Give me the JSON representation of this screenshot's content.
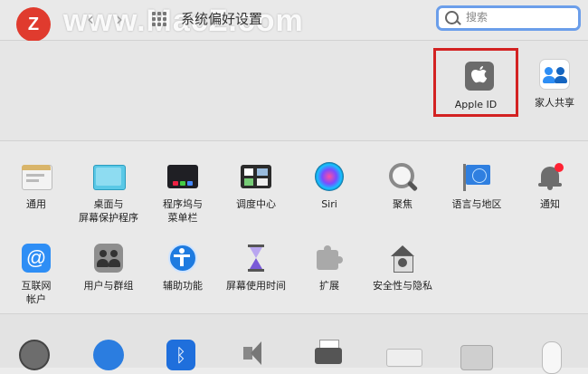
{
  "window": {
    "title": "系统偏好设置"
  },
  "watermark": {
    "text": "www.MacZ.com",
    "logo_letter": "Z"
  },
  "nav": {
    "back": "‹",
    "forward": "›"
  },
  "search": {
    "placeholder": "搜索"
  },
  "account": {
    "apple_id": {
      "label": "Apple ID",
      "icon": "apple-logo-icon"
    },
    "family": {
      "label": "家人共享",
      "icon": "family-icon"
    }
  },
  "highlight_color": "#d32222",
  "prefs": {
    "row1": [
      {
        "label": "通用",
        "icon": "general-icon"
      },
      {
        "label": "桌面与\n屏幕保护程序",
        "icon": "desktop-icon"
      },
      {
        "label": "程序坞与\n菜单栏",
        "icon": "dock-icon"
      },
      {
        "label": "调度中心",
        "icon": "mission-control-icon"
      },
      {
        "label": "Siri",
        "icon": "siri-icon"
      },
      {
        "label": "聚焦",
        "icon": "spotlight-icon"
      },
      {
        "label": "语言与地区",
        "icon": "language-icon"
      },
      {
        "label": "通知",
        "icon": "notification-icon"
      }
    ],
    "row2": [
      {
        "label": "互联网\n帐户",
        "icon": "internet-accounts-icon"
      },
      {
        "label": "用户与群组",
        "icon": "users-icon"
      },
      {
        "label": "辅助功能",
        "icon": "accessibility-icon"
      },
      {
        "label": "屏幕使用时间",
        "icon": "screen-time-icon"
      },
      {
        "label": "扩展",
        "icon": "extensions-icon"
      },
      {
        "label": "安全性与隐私",
        "icon": "security-icon"
      }
    ]
  }
}
